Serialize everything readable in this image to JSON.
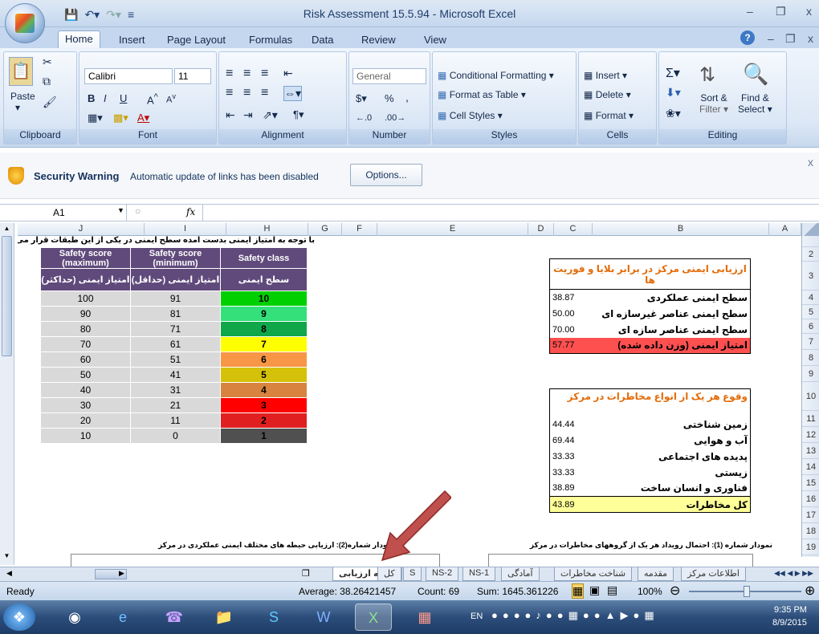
{
  "window": {
    "title": "Risk Assessment 15.5.94 - Microsoft Excel"
  },
  "tabs": [
    "Home",
    "Insert",
    "Page Layout",
    "Formulas",
    "Data",
    "Review",
    "View"
  ],
  "ribbon": {
    "clipboard": {
      "label": "Clipboard",
      "paste": "Paste"
    },
    "font": {
      "label": "Font",
      "name": "Calibri",
      "size": "11"
    },
    "alignment": {
      "label": "Alignment"
    },
    "number": {
      "label": "Number",
      "format": "General",
      "pct": "%",
      "comma": ",",
      "dollar": "$"
    },
    "styles": {
      "label": "Styles",
      "cond": "Conditional Formatting",
      "table": "Format as Table",
      "cell": "Cell Styles"
    },
    "cells": {
      "label": "Cells",
      "insert": "Insert",
      "delete": "Delete",
      "format": "Format"
    },
    "editing": {
      "label": "Editing",
      "sort1": "Sort &",
      "sort2": "Filter",
      "find1": "Find &",
      "find2": "Select"
    }
  },
  "security": {
    "title": "Security Warning",
    "message": "Automatic update of links has been disabled",
    "button": "Options..."
  },
  "formula": {
    "namebox": "A1",
    "fx": "fx",
    "content": ""
  },
  "columns": [
    "J",
    "I",
    "H",
    "G",
    "F",
    "E",
    "D",
    "C",
    "B",
    "A"
  ],
  "rows": [
    "1",
    "2",
    "3",
    "4",
    "5",
    "6",
    "7",
    "8",
    "9",
    "10",
    "11",
    "12",
    "13",
    "14",
    "15",
    "16",
    "17",
    "18",
    "19"
  ],
  "notes": {
    "row1": "با توجه به امتیاز ایمنی بدست آمده سطح ایمنی در یکی از این طبقات قرار می گیرد",
    "chart2": "نمودار شماره(2): ارزیابی حیطه های مختلف ایمنی عملکردی در مرکز",
    "chart1": "نمودار شماره (1): احتمال رویداد هر یک از گروههای مخاطرات در مرکز"
  },
  "safety_table": {
    "headers_en": [
      "Safety score (maximum)",
      "Safety score (minimum)",
      "Safety class"
    ],
    "headers_fa": [
      "امتیاز ایمنی (حداکثر)",
      "امتیاز ایمنی (حداقل)",
      "سطح ایمنی"
    ],
    "rows": [
      {
        "max": "100",
        "min": "91",
        "cls": "10",
        "color": "#00d000"
      },
      {
        "max": "90",
        "min": "81",
        "cls": "9",
        "color": "#33e07a"
      },
      {
        "max": "80",
        "min": "71",
        "cls": "8",
        "color": "#10a64a"
      },
      {
        "max": "70",
        "min": "61",
        "cls": "7",
        "color": "#ffff00"
      },
      {
        "max": "60",
        "min": "51",
        "cls": "6",
        "color": "#f79646"
      },
      {
        "max": "50",
        "min": "41",
        "cls": "5",
        "color": "#d6c10a"
      },
      {
        "max": "40",
        "min": "31",
        "cls": "4",
        "color": "#d88440"
      },
      {
        "max": "30",
        "min": "21",
        "cls": "3",
        "color": "#ff0000"
      },
      {
        "max": "20",
        "min": "11",
        "cls": "2",
        "color": "#e02020"
      },
      {
        "max": "10",
        "min": "0",
        "cls": "1",
        "color": "#505050"
      }
    ]
  },
  "assess_table": {
    "title": "ارزیابی ایمنی مرکز در برابر بلایا و فوریت ها",
    "rows": [
      {
        "label": "سطح ایمنی عملکردی",
        "value": "38.87"
      },
      {
        "label": "سطح ایمنی عناصر غیرسازه ای",
        "value": "50.00"
      },
      {
        "label": "سطح ایمنی عناصر سازه ای",
        "value": "70.00"
      },
      {
        "label": "امتیاز ایمنی (وزن داده شده)",
        "value": "57.77"
      }
    ]
  },
  "hazard_table": {
    "title": "وقوع هر یک از انواع مخاطرات در مرکز",
    "rows": [
      {
        "label": "زمین شناختی",
        "value": "44.44"
      },
      {
        "label": "آب و هوایی",
        "value": "69.44"
      },
      {
        "label": "پدیده های اجتماعی",
        "value": "33.33"
      },
      {
        "label": "زیستی",
        "value": "33.33"
      },
      {
        "label": "فناوری و انسان ساخت",
        "value": "38.89"
      },
      {
        "label": "کل مخاطرات",
        "value": "43.89"
      }
    ]
  },
  "sheets": [
    "اطلاعات مرکز",
    "مقدمه",
    "شناخت مخاطرات",
    "آمادگی",
    "NS-1",
    "NS-2",
    "S",
    "کل",
    "نتیجه ارزیابی"
  ],
  "status": {
    "ready": "Ready",
    "average": "Average: 38.26421457",
    "count": "Count: 69",
    "sum": "Sum: 1645.361226",
    "zoom": "100%"
  },
  "taskbar": {
    "lang": "EN",
    "time": "9:35 PM",
    "date": "8/9/2015"
  },
  "colors": {
    "purple": "#604a7b",
    "orange": "#e36c09",
    "red": "#ff5050",
    "yellow": "#ffff99"
  }
}
